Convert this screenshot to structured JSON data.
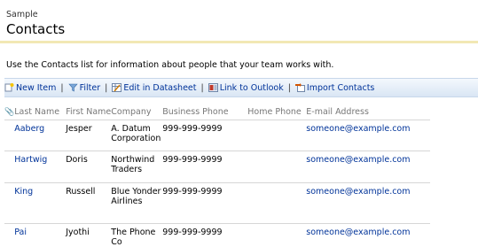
{
  "site": {
    "name": "Sample"
  },
  "page": {
    "title": "Contacts",
    "description": "Use the Contacts list for information about people that your team works with."
  },
  "toolbar": {
    "new_item": "New Item",
    "filter": "Filter",
    "edit_in_datasheet": "Edit in Datasheet",
    "link_to_outlook": "Link to Outlook",
    "import_contacts": "Import Contacts",
    "separator": "|"
  },
  "columns": {
    "attachment": "📎",
    "last_name": "Last Name",
    "first_name": "First Name",
    "company": "Company",
    "business_phone": "Business Phone",
    "home_phone": "Home Phone",
    "email": "E-mail Address"
  },
  "rows": [
    {
      "last_name": "Aaberg",
      "first_name": "Jesper",
      "company": "A. Datum Corporation",
      "business_phone": "999-999-9999",
      "home_phone": "",
      "email": "someone@example.com"
    },
    {
      "last_name": "Hartwig",
      "first_name": "Doris",
      "company": "Northwind Traders",
      "business_phone": "999-999-9999",
      "home_phone": "",
      "email": "someone@example.com"
    },
    {
      "last_name": "King",
      "first_name": "Russell",
      "company": "Blue Yonder Airlines",
      "business_phone": "999-999-9999",
      "home_phone": "",
      "email": "someone@example.com"
    },
    {
      "last_name": "Pai",
      "first_name": "Jyothi",
      "company": "The Phone Co",
      "business_phone": "999-999-9999",
      "home_phone": "",
      "email": "someone@example.com"
    }
  ],
  "colors": {
    "link": "#003399",
    "title_rule": "#f2e8b4",
    "toolbar_top": "#f4f8fd",
    "toolbar_bottom": "#d9e6f4"
  },
  "icons": [
    "new-item-icon",
    "filter-icon",
    "datasheet-icon",
    "outlook-icon",
    "import-icon",
    "attachment-icon"
  ]
}
